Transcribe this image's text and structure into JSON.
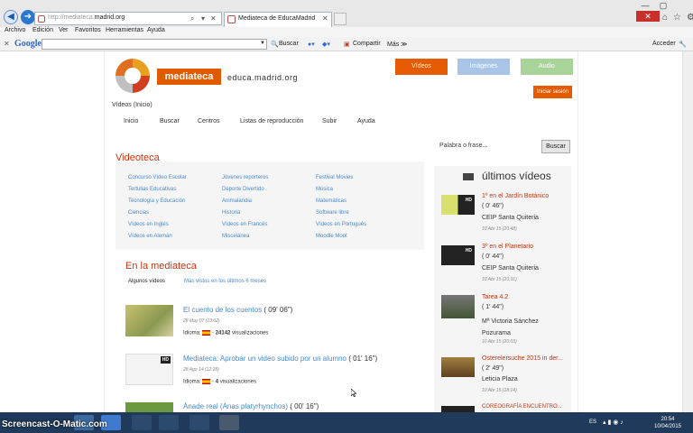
{
  "browser": {
    "address_prefix": "http://mediateca.",
    "address_domain": "madrid.org",
    "tab_title": "Mediateca de EducaMadrid",
    "menu": [
      "Archivo",
      "Edición",
      "Ver",
      "Favoritos",
      "Herramientas",
      "Ayuda"
    ],
    "google": {
      "logo": "Google",
      "buscar": "Buscar",
      "compartir": "Compartir",
      "mas": "Más ≫",
      "acceder": "Acceder"
    }
  },
  "site": {
    "brand": "mediateca",
    "brand_sub": "educa.madrid.org",
    "buttons": {
      "videos": "Vídeos",
      "imagenes": "Imágenes",
      "audio": "Audio",
      "login": "Iniciar sesión"
    },
    "breadcrumb": "Vídeos (Inicio)",
    "nav": [
      "Inicio",
      "Buscar",
      "Centros",
      "Listas de reproducción",
      "Subir",
      "Ayuda"
    ],
    "search": {
      "placeholder": "Palabra o frase...",
      "button": "Buscar"
    }
  },
  "videoteca": {
    "title": "Videoteca",
    "columns": [
      [
        "Concurso Vídeo Escolar",
        "Tertulias Educativas",
        "Tecnología y Educación",
        "Ciencias",
        "Vídeos en Inglés",
        "Vídeos en Alemán"
      ],
      [
        "Jóvenes reporteros",
        "Deporte Divertido",
        "Animalandia",
        "Historia",
        "Vídeos en Francés",
        "Miscelánea"
      ],
      [
        "Festival Movies",
        "Música",
        "Matemáticas",
        "Software libre",
        "Vídeos en Portugués",
        "Moodle Moot"
      ]
    ]
  },
  "en_la_mediateca": {
    "title": "En la mediateca",
    "tabs": {
      "algunos": "Algunos vídeos",
      "mas_vistos": "Más vistos en los últimos 6 meses"
    },
    "items": [
      {
        "title": "El cuento de los cuentos",
        "duration": "( 09' 06\")",
        "date": "28 May 07 (13:02)",
        "idioma_label": "Idioma:",
        "views_num": "24142",
        "views_label": "visualizaciones"
      },
      {
        "title": "Mediateca: Aprobar un video subido por un alumno",
        "duration": "( 01' 16\")",
        "date": "28 Ago 14 (12:28)",
        "idioma_label": "Idioma:",
        "views_num": "4",
        "views_label": "visualizaciones"
      },
      {
        "title": "Ánade real (Anas platyrhynchos)",
        "duration": "( 00' 16\")"
      }
    ]
  },
  "ultimos": {
    "title": "últimos vídeos",
    "items": [
      {
        "title": "1º en el Jardín Botánico",
        "duration": "( 0' 46\")",
        "author": "CEIP Santa Quiteria",
        "date": "10 Abr 15 (20:48)",
        "hd": "HD"
      },
      {
        "title": "3º en el Planetario",
        "duration": "( 0' 44\")",
        "author": "CEIP Santa Quiteria",
        "date": "10 Abr 15 (20:31)",
        "hd": "HD"
      },
      {
        "title": "Tarea 4.2",
        "duration": "( 1' 44\")",
        "author": "Mª Victoria Sánchez Pozurama",
        "date": "10 Abr 15 (20:03)"
      },
      {
        "title": "Osterelersuche 2015 in der...",
        "duration": "( 2' 49\")",
        "author": "Leticia Plaza",
        "date": "10 Abr 15 (18:14)"
      },
      {
        "title": "COREOGRAFÍA ENCUENTRO..."
      }
    ]
  },
  "taskbar": {
    "watermark": "Screencast-O-Matic.com",
    "lang": "ES",
    "time": "20:54",
    "date": "10/04/2015"
  },
  "colors": {
    "accent_orange": "#e65a00",
    "title_red": "#c8360f",
    "link_blue": "#4a8ac8",
    "imagenes_blue": "#a8c5e8",
    "audio_green": "#a8d49a"
  }
}
